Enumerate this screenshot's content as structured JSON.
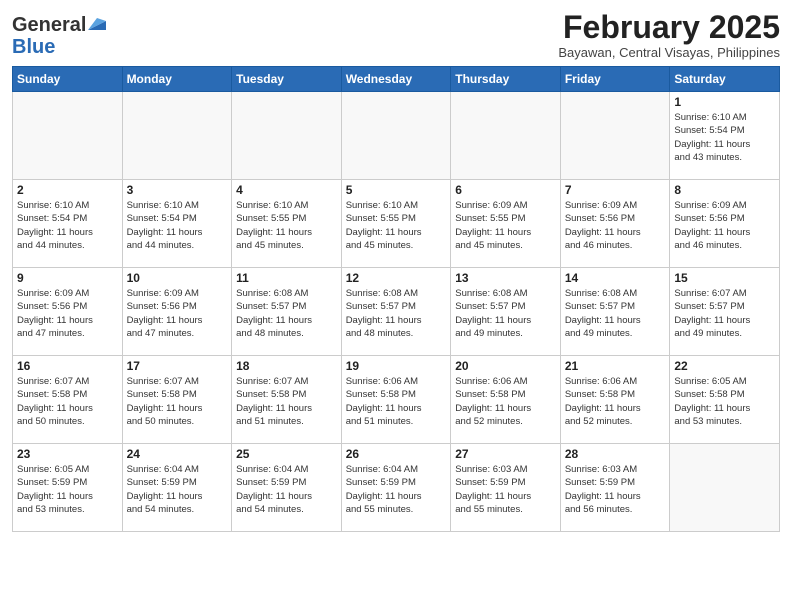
{
  "header": {
    "logo_general": "General",
    "logo_blue": "Blue",
    "month_title": "February 2025",
    "location": "Bayawan, Central Visayas, Philippines"
  },
  "weekdays": [
    "Sunday",
    "Monday",
    "Tuesday",
    "Wednesday",
    "Thursday",
    "Friday",
    "Saturday"
  ],
  "weeks": [
    [
      {
        "day": "",
        "info": ""
      },
      {
        "day": "",
        "info": ""
      },
      {
        "day": "",
        "info": ""
      },
      {
        "day": "",
        "info": ""
      },
      {
        "day": "",
        "info": ""
      },
      {
        "day": "",
        "info": ""
      },
      {
        "day": "1",
        "info": "Sunrise: 6:10 AM\nSunset: 5:54 PM\nDaylight: 11 hours\nand 43 minutes."
      }
    ],
    [
      {
        "day": "2",
        "info": "Sunrise: 6:10 AM\nSunset: 5:54 PM\nDaylight: 11 hours\nand 44 minutes."
      },
      {
        "day": "3",
        "info": "Sunrise: 6:10 AM\nSunset: 5:54 PM\nDaylight: 11 hours\nand 44 minutes."
      },
      {
        "day": "4",
        "info": "Sunrise: 6:10 AM\nSunset: 5:55 PM\nDaylight: 11 hours\nand 45 minutes."
      },
      {
        "day": "5",
        "info": "Sunrise: 6:10 AM\nSunset: 5:55 PM\nDaylight: 11 hours\nand 45 minutes."
      },
      {
        "day": "6",
        "info": "Sunrise: 6:09 AM\nSunset: 5:55 PM\nDaylight: 11 hours\nand 45 minutes."
      },
      {
        "day": "7",
        "info": "Sunrise: 6:09 AM\nSunset: 5:56 PM\nDaylight: 11 hours\nand 46 minutes."
      },
      {
        "day": "8",
        "info": "Sunrise: 6:09 AM\nSunset: 5:56 PM\nDaylight: 11 hours\nand 46 minutes."
      }
    ],
    [
      {
        "day": "9",
        "info": "Sunrise: 6:09 AM\nSunset: 5:56 PM\nDaylight: 11 hours\nand 47 minutes."
      },
      {
        "day": "10",
        "info": "Sunrise: 6:09 AM\nSunset: 5:56 PM\nDaylight: 11 hours\nand 47 minutes."
      },
      {
        "day": "11",
        "info": "Sunrise: 6:08 AM\nSunset: 5:57 PM\nDaylight: 11 hours\nand 48 minutes."
      },
      {
        "day": "12",
        "info": "Sunrise: 6:08 AM\nSunset: 5:57 PM\nDaylight: 11 hours\nand 48 minutes."
      },
      {
        "day": "13",
        "info": "Sunrise: 6:08 AM\nSunset: 5:57 PM\nDaylight: 11 hours\nand 49 minutes."
      },
      {
        "day": "14",
        "info": "Sunrise: 6:08 AM\nSunset: 5:57 PM\nDaylight: 11 hours\nand 49 minutes."
      },
      {
        "day": "15",
        "info": "Sunrise: 6:07 AM\nSunset: 5:57 PM\nDaylight: 11 hours\nand 49 minutes."
      }
    ],
    [
      {
        "day": "16",
        "info": "Sunrise: 6:07 AM\nSunset: 5:58 PM\nDaylight: 11 hours\nand 50 minutes."
      },
      {
        "day": "17",
        "info": "Sunrise: 6:07 AM\nSunset: 5:58 PM\nDaylight: 11 hours\nand 50 minutes."
      },
      {
        "day": "18",
        "info": "Sunrise: 6:07 AM\nSunset: 5:58 PM\nDaylight: 11 hours\nand 51 minutes."
      },
      {
        "day": "19",
        "info": "Sunrise: 6:06 AM\nSunset: 5:58 PM\nDaylight: 11 hours\nand 51 minutes."
      },
      {
        "day": "20",
        "info": "Sunrise: 6:06 AM\nSunset: 5:58 PM\nDaylight: 11 hours\nand 52 minutes."
      },
      {
        "day": "21",
        "info": "Sunrise: 6:06 AM\nSunset: 5:58 PM\nDaylight: 11 hours\nand 52 minutes."
      },
      {
        "day": "22",
        "info": "Sunrise: 6:05 AM\nSunset: 5:58 PM\nDaylight: 11 hours\nand 53 minutes."
      }
    ],
    [
      {
        "day": "23",
        "info": "Sunrise: 6:05 AM\nSunset: 5:59 PM\nDaylight: 11 hours\nand 53 minutes."
      },
      {
        "day": "24",
        "info": "Sunrise: 6:04 AM\nSunset: 5:59 PM\nDaylight: 11 hours\nand 54 minutes."
      },
      {
        "day": "25",
        "info": "Sunrise: 6:04 AM\nSunset: 5:59 PM\nDaylight: 11 hours\nand 54 minutes."
      },
      {
        "day": "26",
        "info": "Sunrise: 6:04 AM\nSunset: 5:59 PM\nDaylight: 11 hours\nand 55 minutes."
      },
      {
        "day": "27",
        "info": "Sunrise: 6:03 AM\nSunset: 5:59 PM\nDaylight: 11 hours\nand 55 minutes."
      },
      {
        "day": "28",
        "info": "Sunrise: 6:03 AM\nSunset: 5:59 PM\nDaylight: 11 hours\nand 56 minutes."
      },
      {
        "day": "",
        "info": ""
      }
    ]
  ]
}
